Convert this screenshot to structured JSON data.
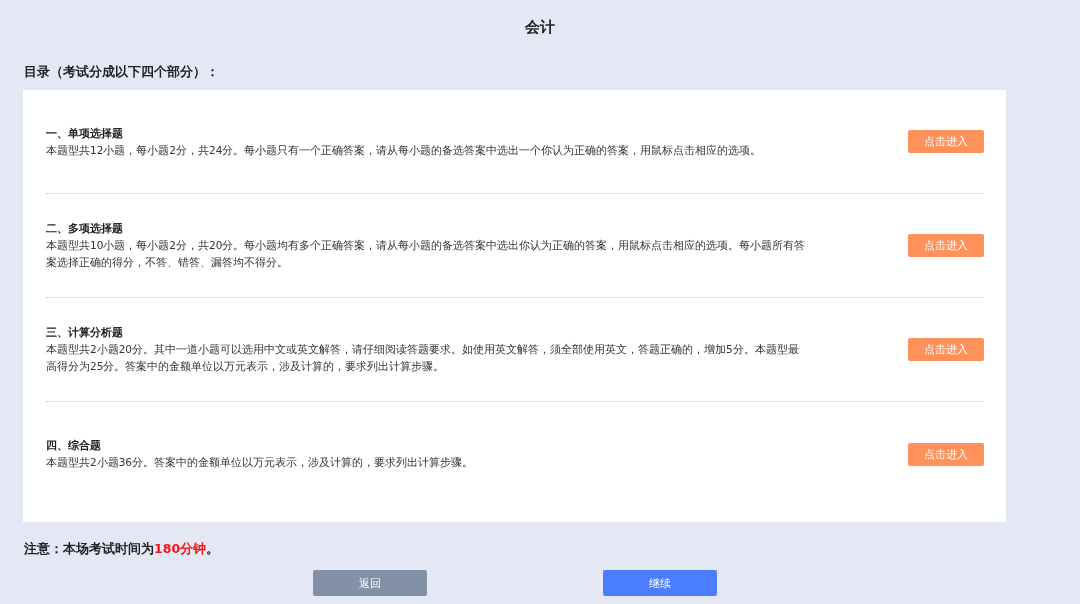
{
  "title": "会计",
  "toc_heading": "目录（考试分成以下四个部分）：",
  "sections": [
    {
      "title": "一、单项选择题",
      "description": "本题型共12小题，每小题2分，共24分。每小题只有一个正确答案，请从每小题的备选答案中选出一个你认为正确的答案，用鼠标点击相应的选项。",
      "button": "点击进入"
    },
    {
      "title": "二、多项选择题",
      "description": "本题型共10小题，每小题2分，共20分。每小题均有多个正确答案，请从每小题的备选答案中选出你认为正确的答案，用鼠标点击相应的选项。每小题所有答案选择正确的得分，不答、错答、漏答均不得分。",
      "button": "点击进入"
    },
    {
      "title": "三、计算分析题",
      "description": "本题型共2小题20分。其中一道小题可以选用中文或英文解答，请仔细阅读答题要求。如使用英文解答，须全部使用英文，答题正确的，增加5分。本题型最高得分为25分。答案中的金额单位以万元表示，涉及计算的，要求列出计算步骤。",
      "button": "点击进入"
    },
    {
      "title": "四、综合题",
      "description": "本题型共2小题36分。答案中的金额单位以万元表示，涉及计算的，要求列出计算步骤。",
      "button": "点击进入"
    }
  ],
  "notice": {
    "prefix": "注意：本场考试时间为",
    "highlight": "180分钟",
    "suffix": "。"
  },
  "buttons": [
    {
      "label": "返回",
      "kind": "secondary"
    },
    {
      "label": "继续",
      "kind": "primary"
    }
  ]
}
